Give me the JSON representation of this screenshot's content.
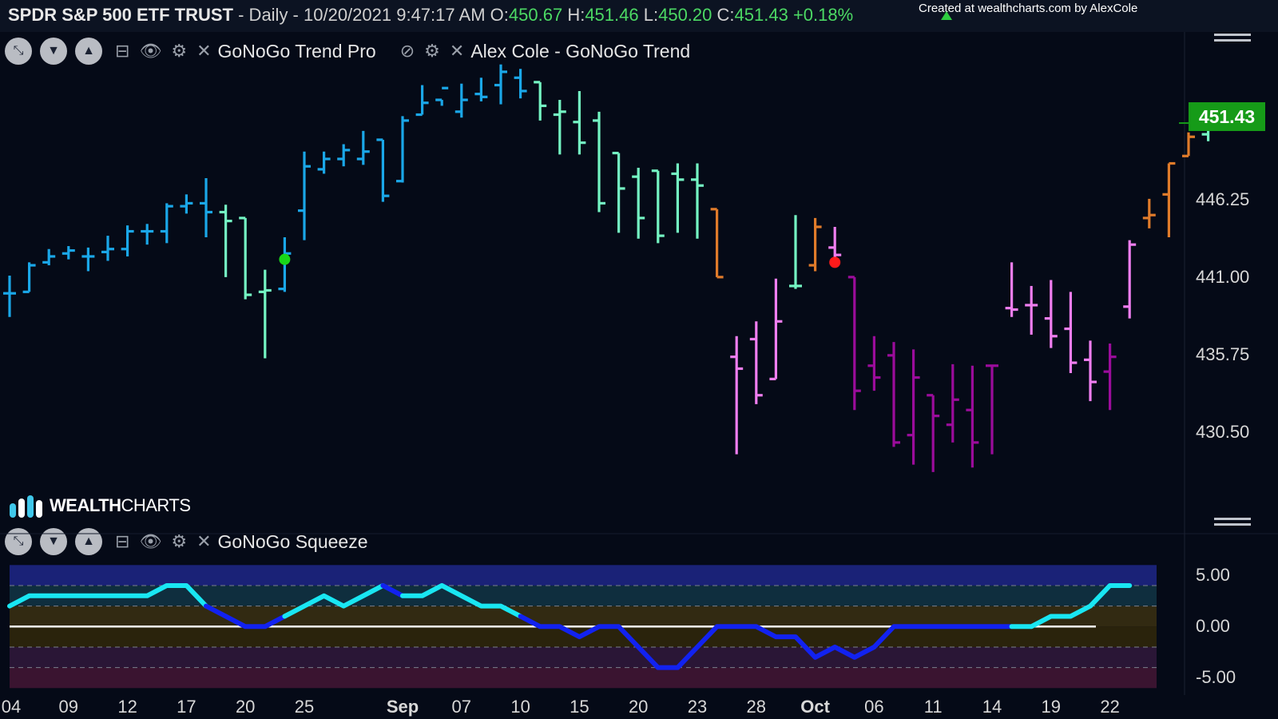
{
  "header": {
    "symbol": "SPDR S&P 500 ETF TRUST",
    "meta": " - Daily - 10/20/2021 9:47:17 AM",
    "o_label": "O:",
    "o_value": "450.67",
    "h_label": "H:",
    "h_value": "451.46",
    "l_label": "L:",
    "l_value": "450.20",
    "c_label": "C:",
    "c_value": "451.43",
    "change": "+0.18%",
    "credit": "Created at wealthcharts.com by AlexCole"
  },
  "toolbar_top": {
    "label_1": "GoNoGo Trend Pro",
    "label_2": "Alex Cole - GoNoGo Trend"
  },
  "toolbar_bottom": {
    "label_1": "GoNoGo Squeeze"
  },
  "logo": {
    "bold": "WEALTH",
    "rest": "CHARTS"
  },
  "price_badge": "451.43",
  "chart_data": [
    {
      "type": "ohlc-bar",
      "title": "SPDR S&P 500 ETF TRUST - Daily",
      "y_ticks": [
        "446.25",
        "441.00",
        "435.75",
        "430.50"
      ],
      "y_range": [
        424.6,
        457.6
      ],
      "x_ticks": [
        {
          "label": "04",
          "i": 0
        },
        {
          "label": "09",
          "i": 3
        },
        {
          "label": "12",
          "i": 6
        },
        {
          "label": "17",
          "i": 9
        },
        {
          "label": "20",
          "i": 12
        },
        {
          "label": "25",
          "i": 15
        },
        {
          "label": "Sep",
          "i": 20,
          "bold": true
        },
        {
          "label": "07",
          "i": 23
        },
        {
          "label": "10",
          "i": 26
        },
        {
          "label": "15",
          "i": 29
        },
        {
          "label": "20",
          "i": 32
        },
        {
          "label": "23",
          "i": 35
        },
        {
          "label": "28",
          "i": 38
        },
        {
          "label": "Oct",
          "i": 41,
          "bold": true
        },
        {
          "label": "06",
          "i": 44
        },
        {
          "label": "11",
          "i": 47
        },
        {
          "label": "14",
          "i": 50
        },
        {
          "label": "19",
          "i": 53
        },
        {
          "label": "22",
          "i": 56
        }
      ],
      "colors": {
        "go_strong": "#1aa7e8",
        "go_weak": "#74f5c3",
        "nogo_weak": "#f07ef0",
        "nogo_strong": "#9b0c9b",
        "amber": "#e07b2a",
        "signal_go": "#19d619",
        "signal_nogo": "#ff1a1a"
      },
      "bars": [
        {
          "i": 0,
          "o": 439.9,
          "h": 441.1,
          "l": 438.3,
          "c": 439.9,
          "t": "go_strong"
        },
        {
          "i": 1,
          "o": 440.0,
          "h": 442.0,
          "l": 440.0,
          "c": 441.8,
          "t": "go_strong"
        },
        {
          "i": 2,
          "o": 442.0,
          "h": 442.9,
          "l": 441.8,
          "c": 442.4,
          "t": "go_strong"
        },
        {
          "i": 3,
          "o": 442.6,
          "h": 443.1,
          "l": 442.2,
          "c": 442.8,
          "t": "go_strong"
        },
        {
          "i": 4,
          "o": 442.4,
          "h": 443.0,
          "l": 441.4,
          "c": 442.4,
          "t": "go_strong"
        },
        {
          "i": 5,
          "o": 442.7,
          "h": 443.8,
          "l": 442.1,
          "c": 442.9,
          "t": "go_strong"
        },
        {
          "i": 6,
          "o": 442.9,
          "h": 444.5,
          "l": 442.4,
          "c": 444.1,
          "t": "go_strong"
        },
        {
          "i": 7,
          "o": 444.1,
          "h": 444.6,
          "l": 443.2,
          "c": 444.1,
          "t": "go_strong"
        },
        {
          "i": 8,
          "o": 444.1,
          "h": 446.0,
          "l": 443.3,
          "c": 445.8,
          "t": "go_strong"
        },
        {
          "i": 9,
          "o": 445.8,
          "h": 446.6,
          "l": 445.3,
          "c": 446.0,
          "t": "go_strong"
        },
        {
          "i": 10,
          "o": 446.0,
          "h": 447.7,
          "l": 443.7,
          "c": 445.4,
          "t": "go_strong"
        },
        {
          "i": 11,
          "o": 445.4,
          "h": 445.9,
          "l": 441.0,
          "c": 444.8,
          "t": "go_weak"
        },
        {
          "i": 12,
          "o": 445.0,
          "h": 445.0,
          "l": 439.5,
          "c": 439.8,
          "t": "go_weak"
        },
        {
          "i": 13,
          "o": 440.0,
          "h": 441.5,
          "l": 435.5,
          "c": 440.1,
          "t": "go_weak"
        },
        {
          "i": 14,
          "o": 440.2,
          "h": 443.7,
          "l": 440.0,
          "c": 442.6,
          "t": "go_strong"
        },
        {
          "i": 15,
          "o": 445.5,
          "h": 449.5,
          "l": 443.5,
          "c": 448.5,
          "t": "go_strong"
        },
        {
          "i": 16,
          "o": 448.3,
          "h": 449.5,
          "l": 448.0,
          "c": 449.0,
          "t": "go_strong"
        },
        {
          "i": 17,
          "o": 449.0,
          "h": 450.0,
          "l": 448.5,
          "c": 449.6,
          "t": "go_strong"
        },
        {
          "i": 18,
          "o": 449.0,
          "h": 450.9,
          "l": 448.6,
          "c": 449.5,
          "t": "go_strong"
        },
        {
          "i": 19,
          "o": 450.3,
          "h": 450.3,
          "l": 446.1,
          "c": 446.5,
          "t": "go_strong"
        },
        {
          "i": 20,
          "o": 447.5,
          "h": 451.9,
          "l": 447.4,
          "c": 451.6,
          "t": "go_strong"
        },
        {
          "i": 21,
          "o": 452.0,
          "h": 454.0,
          "l": 452.0,
          "c": 452.8,
          "t": "go_strong"
        },
        {
          "i": 22,
          "o": 453.0,
          "h": 453.0,
          "l": 452.6,
          "c": 453.8,
          "t": "go_strong"
        },
        {
          "i": 23,
          "o": 452.2,
          "h": 454.1,
          "l": 451.8,
          "c": 453.0,
          "t": "go_strong"
        },
        {
          "i": 24,
          "o": 453.4,
          "h": 454.5,
          "l": 452.9,
          "c": 453.2,
          "t": "go_strong"
        },
        {
          "i": 25,
          "o": 454.0,
          "h": 455.4,
          "l": 452.7,
          "c": 454.9,
          "t": "go_strong"
        },
        {
          "i": 26,
          "o": 454.5,
          "h": 455.1,
          "l": 453.1,
          "c": 453.6,
          "t": "go_strong"
        },
        {
          "i": 27,
          "o": 454.2,
          "h": 454.2,
          "l": 451.6,
          "c": 452.6,
          "t": "go_weak"
        },
        {
          "i": 28,
          "o": 452.0,
          "h": 453.0,
          "l": 449.3,
          "c": 452.2,
          "t": "go_weak"
        },
        {
          "i": 29,
          "o": 451.5,
          "h": 453.6,
          "l": 449.3,
          "c": 450.1,
          "t": "go_weak"
        },
        {
          "i": 30,
          "o": 451.6,
          "h": 452.2,
          "l": 445.4,
          "c": 446.0,
          "t": "go_weak"
        },
        {
          "i": 31,
          "o": 449.4,
          "h": 449.4,
          "l": 444.0,
          "c": 447.0,
          "t": "go_weak"
        },
        {
          "i": 32,
          "o": 447.8,
          "h": 448.4,
          "l": 443.6,
          "c": 445.0,
          "t": "go_weak"
        },
        {
          "i": 33,
          "o": 448.2,
          "h": 448.2,
          "l": 443.3,
          "c": 443.8,
          "t": "go_weak"
        },
        {
          "i": 34,
          "o": 448.0,
          "h": 448.7,
          "l": 444.0,
          "c": 447.6,
          "t": "go_weak"
        },
        {
          "i": 35,
          "o": 447.6,
          "h": 448.7,
          "l": 443.6,
          "c": 447.2,
          "t": "go_weak"
        },
        {
          "i": 36,
          "o": 445.6,
          "h": 445.6,
          "l": 441.0,
          "c": 441.0,
          "t": "amber"
        },
        {
          "i": 37,
          "o": 435.6,
          "h": 437.0,
          "l": 429.0,
          "c": 434.8,
          "t": "nogo_weak"
        },
        {
          "i": 38,
          "o": 436.8,
          "h": 438.0,
          "l": 432.4,
          "c": 433.0,
          "t": "nogo_weak"
        },
        {
          "i": 39,
          "o": 434.1,
          "h": 440.9,
          "l": 434.1,
          "c": 438.0,
          "t": "nogo_weak"
        },
        {
          "i": 40,
          "o": 440.4,
          "h": 445.2,
          "l": 440.2,
          "c": 440.4,
          "t": "go_weak"
        },
        {
          "i": 41,
          "o": 441.8,
          "h": 445.0,
          "l": 441.4,
          "c": 444.4,
          "t": "amber"
        },
        {
          "i": 42,
          "o": 443.0,
          "h": 444.4,
          "l": 441.9,
          "c": 442.5,
          "t": "nogo_weak"
        },
        {
          "i": 43,
          "o": 441.0,
          "h": 441.0,
          "l": 432.0,
          "c": 433.3,
          "t": "nogo_strong"
        },
        {
          "i": 44,
          "o": 435.0,
          "h": 437.0,
          "l": 433.3,
          "c": 434.2,
          "t": "nogo_strong"
        },
        {
          "i": 45,
          "o": 435.7,
          "h": 436.6,
          "l": 429.5,
          "c": 429.8,
          "t": "nogo_strong"
        },
        {
          "i": 46,
          "o": 430.3,
          "h": 436.1,
          "l": 428.3,
          "c": 434.2,
          "t": "nogo_strong"
        },
        {
          "i": 47,
          "o": 433.0,
          "h": 433.0,
          "l": 427.8,
          "c": 431.6,
          "t": "nogo_strong"
        },
        {
          "i": 48,
          "o": 431.0,
          "h": 435.1,
          "l": 429.8,
          "c": 432.7,
          "t": "nogo_strong"
        },
        {
          "i": 49,
          "o": 432.0,
          "h": 435.0,
          "l": 428.1,
          "c": 429.8,
          "t": "nogo_strong"
        },
        {
          "i": 50,
          "o": 435.0,
          "h": 435.0,
          "l": 429.0,
          "c": 435.0,
          "t": "nogo_strong"
        },
        {
          "i": 51,
          "o": 438.9,
          "h": 442.0,
          "l": 438.3,
          "c": 438.8,
          "t": "nogo_weak"
        },
        {
          "i": 52,
          "o": 439.1,
          "h": 440.4,
          "l": 437.1,
          "c": 439.1,
          "t": "nogo_weak"
        },
        {
          "i": 53,
          "o": 438.2,
          "h": 440.8,
          "l": 436.2,
          "c": 437.0,
          "t": "nogo_weak"
        },
        {
          "i": 54,
          "o": 437.5,
          "h": 440.0,
          "l": 434.5,
          "c": 435.2,
          "t": "nogo_weak"
        },
        {
          "i": 55,
          "o": 435.4,
          "h": 436.7,
          "l": 432.6,
          "c": 433.9,
          "t": "nogo_weak"
        },
        {
          "i": 56,
          "o": 434.6,
          "h": 436.5,
          "l": 432.0,
          "c": 435.6,
          "t": "nogo_strong"
        },
        {
          "i": 57,
          "o": 439.0,
          "h": 443.5,
          "l": 438.2,
          "c": 443.2,
          "t": "nogo_weak"
        },
        {
          "i": 58,
          "o": 445.0,
          "h": 446.3,
          "l": 444.3,
          "c": 445.2,
          "t": "amber"
        },
        {
          "i": 59,
          "o": 446.6,
          "h": 448.7,
          "l": 443.7,
          "c": 448.7,
          "t": "amber"
        },
        {
          "i": 60,
          "o": 449.2,
          "h": 450.8,
          "l": 449.2,
          "c": 450.5,
          "t": "amber"
        },
        {
          "i": 61,
          "o": 450.67,
          "h": 451.46,
          "l": 450.2,
          "c": 451.43,
          "t": "go_weak"
        }
      ],
      "signals": [
        {
          "i": 14,
          "price": 442.2,
          "t": "signal_go"
        },
        {
          "i": 42,
          "price": 442.0,
          "t": "signal_nogo"
        }
      ]
    },
    {
      "type": "line",
      "title": "GoNoGo Squeeze",
      "y_ticks": [
        "5.00",
        "0.00",
        "-5.00"
      ],
      "y_range": [
        -5.9,
        6.1
      ],
      "zero_line": 0,
      "colors": {
        "up": "#19e6f2",
        "down": "#1222f0",
        "zero": "#ffffff"
      },
      "bands": [
        {
          "from": 4.0,
          "to": 6.0,
          "color": "#1a2277"
        },
        {
          "from": 2.0,
          "to": 4.0,
          "color": "#0f2e3e"
        },
        {
          "from": 0.0,
          "to": 2.0,
          "color": "#322a12"
        },
        {
          "from": -2.0,
          "to": 0.0,
          "color": "#2a230c"
        },
        {
          "from": -4.0,
          "to": -2.0,
          "color": "#2a1636"
        },
        {
          "from": -6.0,
          "to": -4.0,
          "color": "#3a1430"
        }
      ],
      "values": [
        2,
        3,
        3,
        3,
        3,
        3,
        3,
        3,
        4,
        4,
        2,
        1,
        0,
        0,
        1,
        2,
        3,
        2,
        3,
        4,
        3,
        3,
        4,
        3,
        2,
        2,
        1,
        0,
        0,
        -1,
        0,
        0,
        -2,
        -4,
        -4,
        -2,
        0,
        0,
        0,
        -1,
        -1,
        -3,
        -2,
        -3,
        -2,
        0,
        0,
        0,
        0,
        0,
        0,
        0,
        0,
        1,
        1,
        2,
        4,
        4
      ],
      "down_segments": [
        [
          10,
          14
        ],
        [
          19,
          20
        ],
        [
          26,
          51
        ]
      ]
    }
  ]
}
